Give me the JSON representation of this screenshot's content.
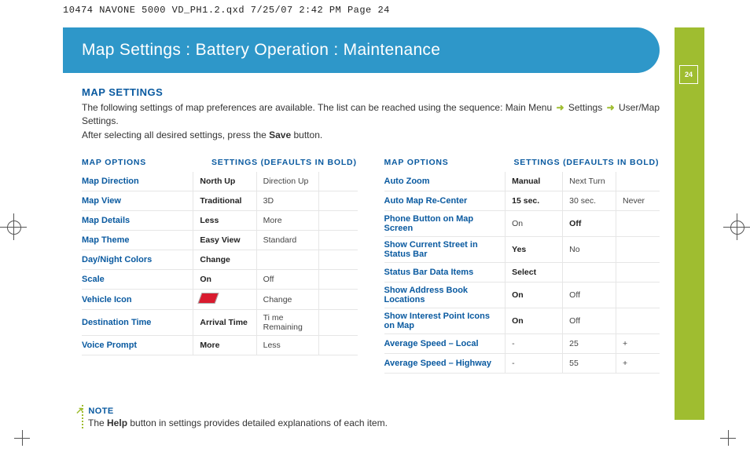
{
  "slug": "10474 NAVONE 5000 VD_PH1.2.qxd  7/25/07  2:42 PM  Page 24",
  "page_number": "24",
  "header_title": "Map Settings : Battery Operation : Maintenance",
  "section_heading": "MAP SETTINGS",
  "intro_before": "The following settings of map preferences are available. The list can be reached using the sequence: Main Menu ",
  "intro_seq1": "Settings",
  "intro_seq2": "User/Map Settings.",
  "intro_line2_a": "After selecting all desired settings, press the ",
  "intro_save": "Save",
  "intro_line2_b": " button.",
  "col_options": "MAP OPTIONS",
  "col_settings": "SETTINGS (DEFAULTS IN BOLD)",
  "left_rows": [
    {
      "opt": "Map Direction",
      "s1": "North Up",
      "b1": true,
      "s2": "Direction Up",
      "b2": false,
      "s3": "",
      "b3": false
    },
    {
      "opt": "Map View",
      "s1": "Traditional",
      "b1": true,
      "s2": "3D",
      "b2": false,
      "s3": "",
      "b3": false
    },
    {
      "opt": "Map Details",
      "s1": "Less",
      "b1": true,
      "s2": "More",
      "b2": false,
      "s3": "",
      "b3": false
    },
    {
      "opt": "Map Theme",
      "s1": "Easy View",
      "b1": true,
      "s2": "Standard",
      "b2": false,
      "s3": "",
      "b3": false
    },
    {
      "opt": "Day/Night Colors",
      "s1": "Change",
      "b1": true,
      "s2": "",
      "b2": false,
      "s3": "",
      "b3": false
    },
    {
      "opt": "Scale",
      "s1": "On",
      "b1": true,
      "s2": "Off",
      "b2": false,
      "s3": "",
      "b3": false
    },
    {
      "opt": "Vehicle Icon",
      "s1": "__ICON__",
      "b1": false,
      "s2": "Change",
      "b2": false,
      "s3": "",
      "b3": false
    },
    {
      "opt": "Destination Time",
      "s1": "Arrival Time",
      "b1": true,
      "s2": "Ti me Remaining",
      "b2": false,
      "s3": "",
      "b3": false
    },
    {
      "opt": "Voice Prompt",
      "s1": "More",
      "b1": true,
      "s2": "Less",
      "b2": false,
      "s3": "",
      "b3": false
    }
  ],
  "right_rows": [
    {
      "opt": "Auto Zoom",
      "s1": "Manual",
      "b1": true,
      "s2": "Next Turn",
      "b2": false,
      "s3": "",
      "b3": false
    },
    {
      "opt": "Auto Map Re-Center",
      "s1": "15 sec.",
      "b1": true,
      "s2": "30 sec.",
      "b2": false,
      "s3": "Never",
      "b3": false
    },
    {
      "opt": "Phone Button on Map Screen",
      "s1": "On",
      "b1": false,
      "s2": "Off",
      "b2": true,
      "s3": "",
      "b3": false
    },
    {
      "opt": "Show Current Street in Status Bar",
      "s1": "Yes",
      "b1": true,
      "s2": "No",
      "b2": false,
      "s3": "",
      "b3": false
    },
    {
      "opt": "Status Bar Data Items",
      "s1": "Select",
      "b1": true,
      "s2": "",
      "b2": false,
      "s3": "",
      "b3": false
    },
    {
      "opt": "Show Address Book Locations",
      "s1": "On",
      "b1": true,
      "s2": "Off",
      "b2": false,
      "s3": "",
      "b3": false
    },
    {
      "opt": "Show Interest Point Icons on Map",
      "s1": "On",
      "b1": true,
      "s2": "Off",
      "b2": false,
      "s3": "",
      "b3": false
    },
    {
      "opt": "Average Speed – Local",
      "s1": "-",
      "b1": false,
      "s2": "25",
      "b2": false,
      "s3": "+",
      "b3": false
    },
    {
      "opt": "Average Speed – Highway",
      "s1": "-",
      "b1": false,
      "s2": "55",
      "b2": false,
      "s3": "+",
      "b3": false
    }
  ],
  "note_label": "NOTE",
  "note_text_a": "The ",
  "note_help": "Help",
  "note_text_b": " button in settings provides detailed explanations of each item."
}
